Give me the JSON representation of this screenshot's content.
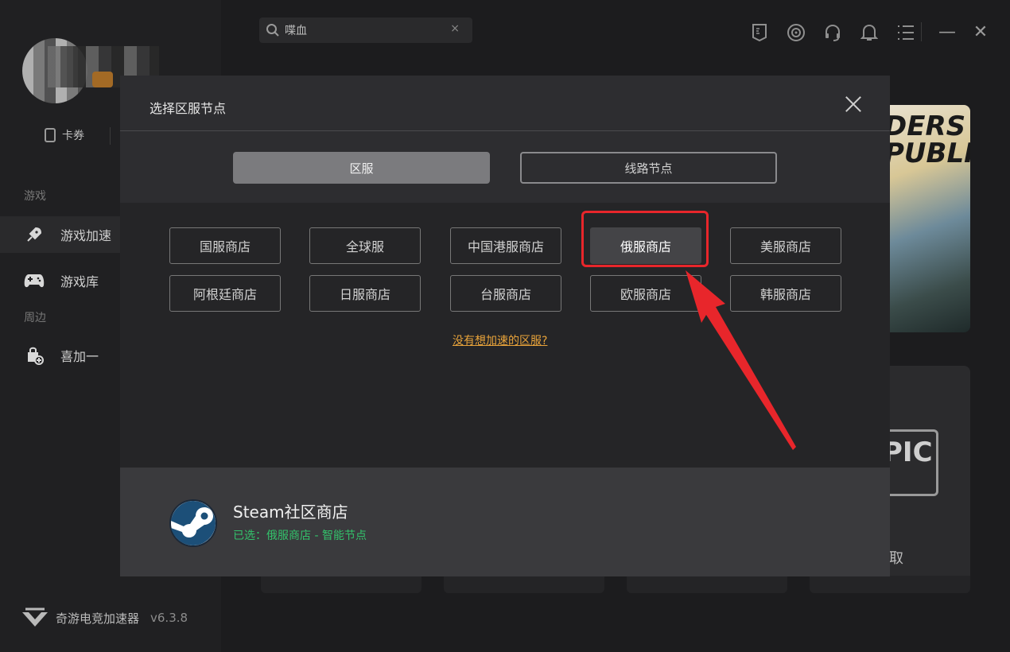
{
  "app": {
    "brand_name": "奇游电竞加速器",
    "version": "v6.3.8"
  },
  "sidebar": {
    "coupon_label": "卡券",
    "section_games": "游戏",
    "section_nearby": "周边",
    "items": [
      {
        "label": "游戏加速",
        "icon": "rocket-icon"
      },
      {
        "label": "游戏库",
        "icon": "gamepad-icon"
      },
      {
        "label": "喜加一",
        "icon": "bag-plus-icon"
      }
    ]
  },
  "search": {
    "value": "喋血",
    "clear_glyph": "×"
  },
  "window_controls": {
    "minimize": "—",
    "close": "✕"
  },
  "background_cards": {
    "card1_title": "DERS\nPUBLIC",
    "card2_logo": "PIC",
    "card2_action": "取"
  },
  "modal": {
    "title": "选择区服节点",
    "tabs": [
      {
        "label": "区服",
        "active": true
      },
      {
        "label": "线路节点",
        "active": false
      }
    ],
    "regions": [
      [
        "国服商店",
        "全球服",
        "中国港服商店",
        "俄服商店",
        "美服商店"
      ],
      [
        "阿根廷商店",
        "日服商店",
        "台服商店",
        "欧服商店",
        "韩服商店"
      ]
    ],
    "selected_region": "俄服商店",
    "help_link": "没有想加速的区服?",
    "footer": {
      "store_name": "Steam社区商店",
      "selected_text": "已选：俄服商店 - 智能节点"
    }
  },
  "colors": {
    "accent_orange": "#e8a33a",
    "selected_green": "#33c26b",
    "highlight_red": "#e8262b"
  }
}
